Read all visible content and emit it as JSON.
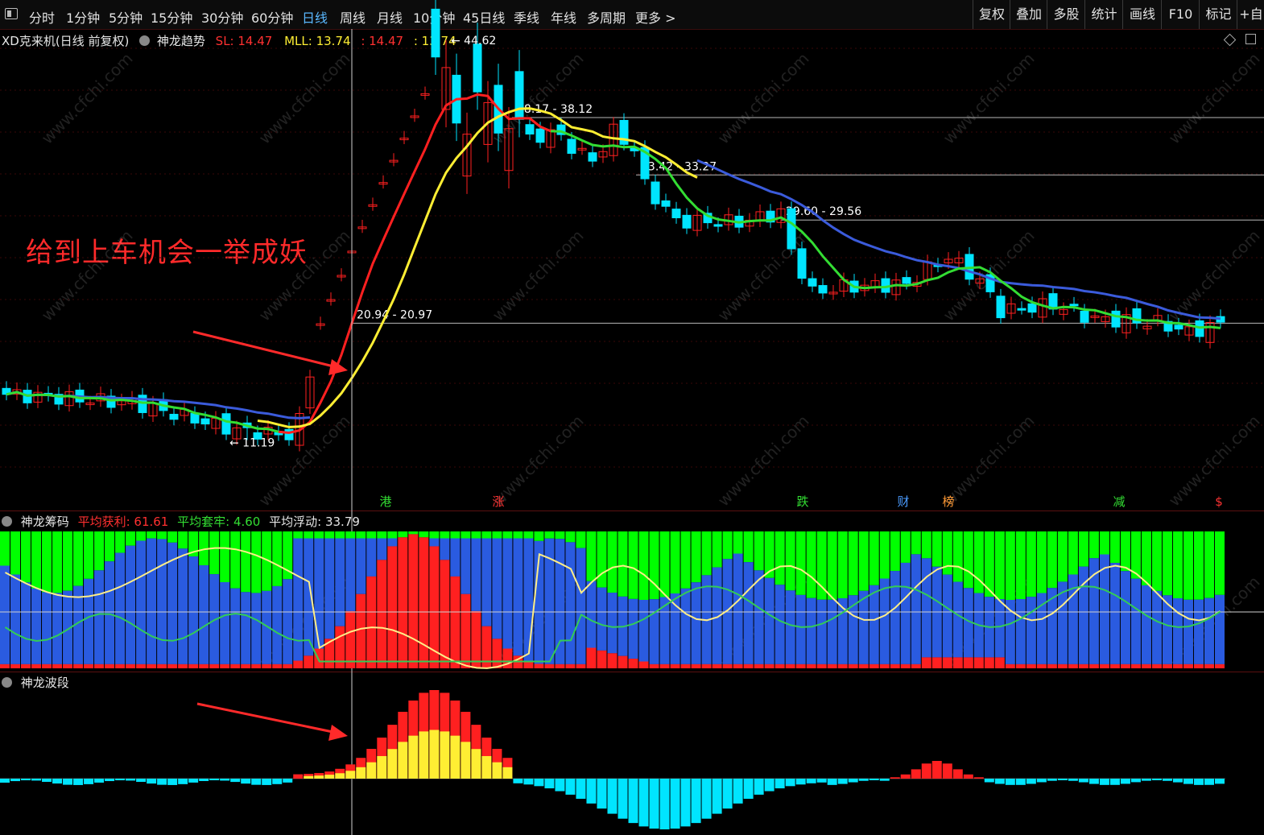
{
  "toolbar": {
    "periods": [
      "分时",
      "1分钟",
      "5分钟",
      "15分钟",
      "30分钟",
      "60分钟",
      "日线",
      "周线",
      "月线",
      "10分钟",
      "45日线",
      "季线",
      "年线",
      "多周期",
      "更多 >"
    ],
    "active_period": "日线",
    "right_buttons": [
      "复权",
      "叠加",
      "多股",
      "统计",
      "画线",
      "F10",
      "标记",
      "+自"
    ]
  },
  "main_panel": {
    "stock_title": "XD克来机(日线 前复权)",
    "indicator_name": "神龙趋势",
    "sl_label": "SL: 14.47",
    "mll_label": "MLL: 13.74",
    "val1": ": 14.47",
    "val2": ": 13.74",
    "high_label": "44.62",
    "low_label": "11.19",
    "annotation": "给到上车机会一举成妖",
    "levels": [
      {
        "label": "38.17 - 38.12",
        "price": 38.15
      },
      {
        "label": "33.42 - 33.27",
        "price": 33.35
      },
      {
        "label": "29.60 - 29.56",
        "price": 29.58
      },
      {
        "label": "20.94 - 20.97",
        "price": 20.95
      }
    ],
    "event_tags": [
      {
        "text": "港",
        "color": "#33dd33"
      },
      {
        "text": "涨",
        "color": "#ff3333"
      },
      {
        "text": "跌",
        "color": "#33dd33"
      },
      {
        "text": "财",
        "color": "#4a9bff"
      },
      {
        "text": "榜",
        "color": "#ff9933"
      },
      {
        "text": "减",
        "color": "#33dd33"
      },
      {
        "text": "$",
        "color": "#ff3333"
      }
    ]
  },
  "chip_panel": {
    "name": "神龙筹码",
    "profit_label": "平均获利: 61.61",
    "trapped_label": "平均套牢: 4.60",
    "float_label": "平均浮动: 33.79"
  },
  "wave_panel": {
    "name": "神龙波段"
  },
  "watermark": "www.cfchi.com",
  "colors": {
    "up": "#ff2020",
    "down": "#00e5ff",
    "ma_red": "#ff2020",
    "ma_yellow": "#ffee33",
    "ma_green": "#33dd33",
    "ma_blue": "#3b5bdb",
    "chip_green": "#00ff00",
    "chip_blue": "#2a5be0"
  }
}
